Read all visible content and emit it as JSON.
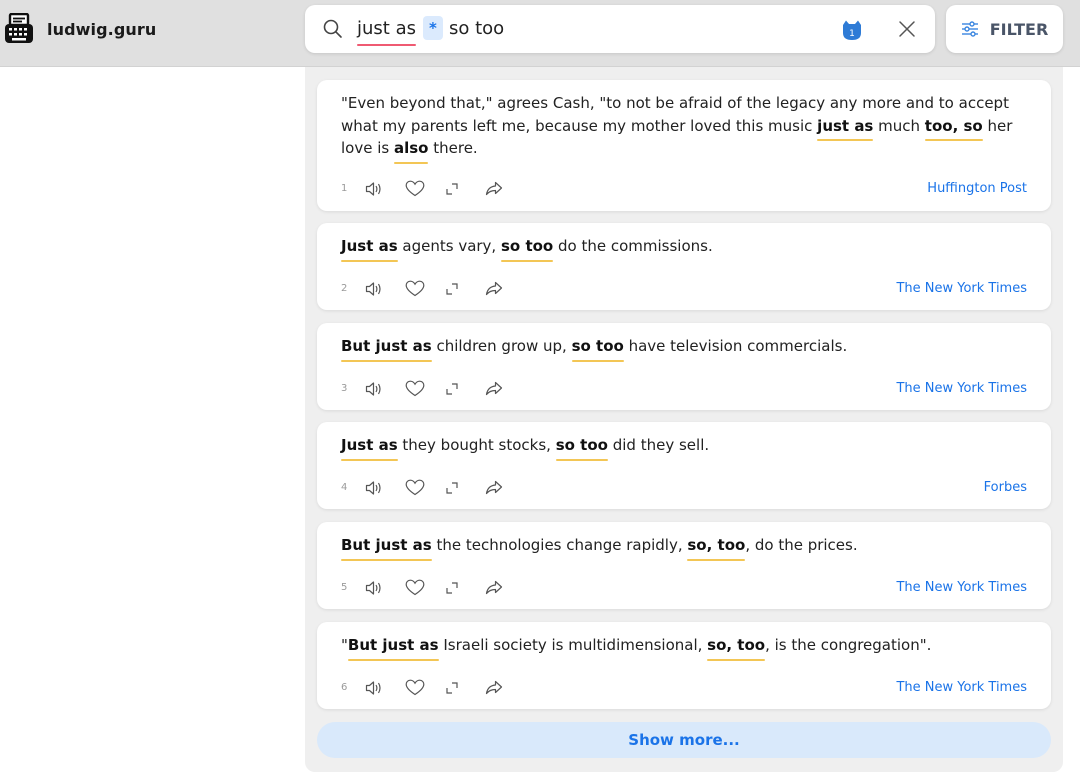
{
  "header": {
    "logo_text": "ludwig.guru"
  },
  "search": {
    "query_first": "just as",
    "wildcard": "*",
    "query_last": "so too",
    "badge_count": "1",
    "filter_label": "FILTER"
  },
  "results": [
    {
      "num": "1",
      "segments": [
        {
          "t": "\"Even beyond that,\" agrees Cash, \"to not be afraid of the legacy any more and to accept what my parents left me, because my mother loved this music ",
          "b": false
        },
        {
          "t": "just as",
          "b": true
        },
        {
          "t": " much ",
          "b": false
        },
        {
          "t": "too, so",
          "b": true
        },
        {
          "t": " her love is ",
          "b": false
        },
        {
          "t": "also",
          "b": true
        },
        {
          "t": " there.",
          "b": false
        }
      ],
      "source": "Huffington Post"
    },
    {
      "num": "2",
      "segments": [
        {
          "t": "Just as",
          "b": true
        },
        {
          "t": " agents vary, ",
          "b": false
        },
        {
          "t": "so too",
          "b": true
        },
        {
          "t": " do the commissions.",
          "b": false
        }
      ],
      "source": "The New York Times"
    },
    {
      "num": "3",
      "segments": [
        {
          "t": "But just as",
          "b": true
        },
        {
          "t": " children grow up, ",
          "b": false
        },
        {
          "t": "so too",
          "b": true
        },
        {
          "t": " have television commercials.",
          "b": false
        }
      ],
      "source": "The New York Times"
    },
    {
      "num": "4",
      "segments": [
        {
          "t": "Just as",
          "b": true
        },
        {
          "t": " they bought stocks, ",
          "b": false
        },
        {
          "t": "so too",
          "b": true
        },
        {
          "t": " did they sell.",
          "b": false
        }
      ],
      "source": "Forbes"
    },
    {
      "num": "5",
      "segments": [
        {
          "t": "But just as",
          "b": true
        },
        {
          "t": " the technologies change rapidly, ",
          "b": false
        },
        {
          "t": "so, too",
          "b": true
        },
        {
          "t": ", do the prices.",
          "b": false
        }
      ],
      "source": "The New York Times"
    },
    {
      "num": "6",
      "segments": [
        {
          "t": "\"",
          "b": false
        },
        {
          "t": "But just as",
          "b": true
        },
        {
          "t": " Israeli society is multidimensional, ",
          "b": false
        },
        {
          "t": "so, too",
          "b": true
        },
        {
          "t": ", is the congregation\".",
          "b": false
        }
      ],
      "source": "The New York Times"
    }
  ],
  "show_more_label": "Show more...",
  "icons": {
    "logo": "typewriter-icon",
    "search": "search-icon",
    "badge": "cat-icon",
    "clear": "close-icon",
    "filter": "sliders-icon",
    "listen": "speaker-icon",
    "like": "heart-icon",
    "expand": "expand-icon",
    "share": "share-icon"
  },
  "colors": {
    "accent": "#1a73e8",
    "highlight_underline": "#f3c655",
    "query_underline": "#ef5a72",
    "show_more_bg": "#d9e9fb"
  }
}
